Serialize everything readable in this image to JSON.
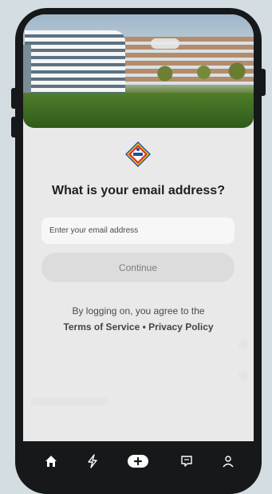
{
  "login": {
    "title": "What is your email address?",
    "email_placeholder": "Enter your email address",
    "email_value": "",
    "continue_label": "Continue",
    "agree_text": "By logging on, you agree to the",
    "terms_label": "Terms of Service",
    "separator": "•",
    "privacy_label": "Privacy Policy"
  },
  "icons": {
    "hero": "campus-building-photo",
    "logo": "organization-diamond-logo",
    "nav": [
      "home-icon",
      "lightning-icon",
      "add-icon",
      "message-icon",
      "profile-icon"
    ]
  },
  "colors": {
    "screen_bg": "#e9e9ea",
    "phone_frame": "#16181a",
    "page_bg": "#d3dde2",
    "button_bg": "#dcdcdc"
  }
}
